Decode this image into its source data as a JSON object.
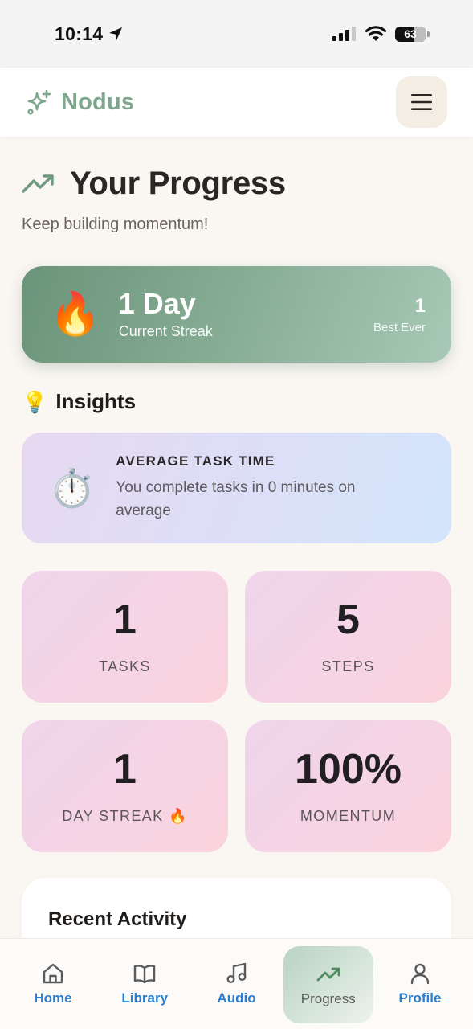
{
  "status_bar": {
    "time": "10:14",
    "battery": "63"
  },
  "header": {
    "brand": "Nodus"
  },
  "main": {
    "title": "Your Progress",
    "subtitle": "Keep building momentum!",
    "streak": {
      "value": "1 Day",
      "label": "Current Streak",
      "best_value": "1",
      "best_label": "Best Ever",
      "icon": "🔥"
    },
    "insights": {
      "title": "Insights",
      "icon": "💡",
      "card": {
        "icon": "⏱️",
        "title": "AVERAGE TASK TIME",
        "text": "You complete tasks in 0 minutes on average"
      }
    },
    "stats": [
      {
        "value": "1",
        "label": "TASKS"
      },
      {
        "value": "5",
        "label": "STEPS"
      },
      {
        "value": "1",
        "label": "DAY STREAK 🔥"
      },
      {
        "value": "100%",
        "label": "MOMENTUM"
      }
    ],
    "recent_activity": {
      "title": "Recent Activity"
    }
  },
  "nav": [
    {
      "label": "Home",
      "icon": "home-icon"
    },
    {
      "label": "Library",
      "icon": "book-icon"
    },
    {
      "label": "Audio",
      "icon": "music-note-icon"
    },
    {
      "label": "Progress",
      "icon": "trending-up-icon",
      "active": true
    },
    {
      "label": "Profile",
      "icon": "user-icon"
    }
  ],
  "colors": {
    "accent_green": "#7ea68c",
    "nav_blue": "#2c7fd0",
    "background": "#faf6f2"
  }
}
